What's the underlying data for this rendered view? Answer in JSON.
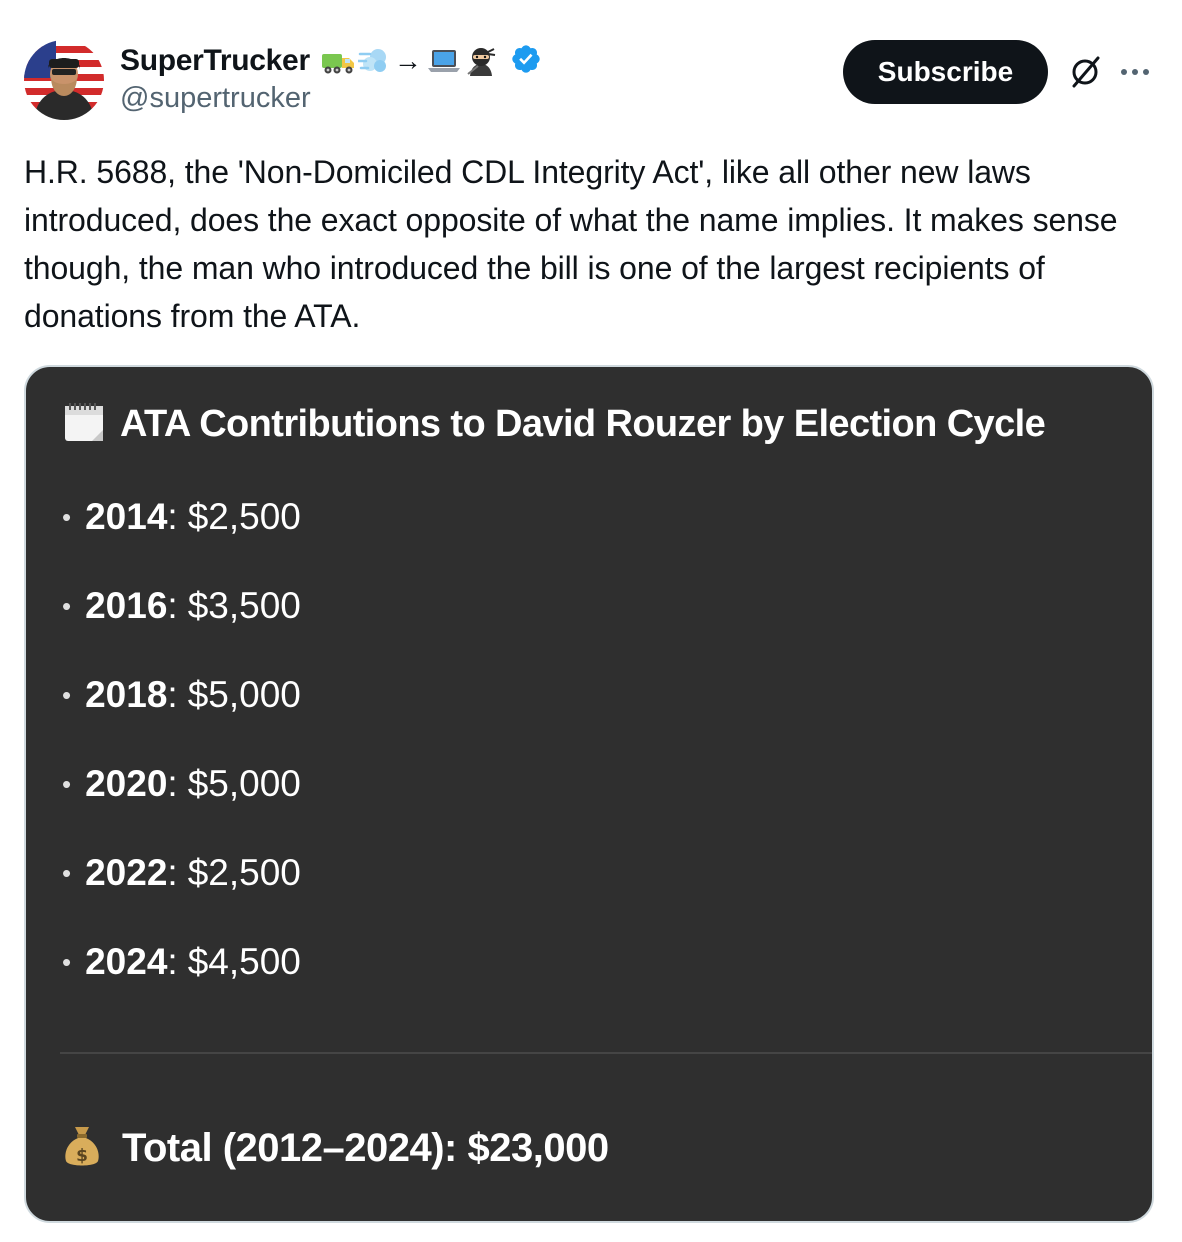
{
  "author": {
    "display_name": "SuperTrucker",
    "handle": "@supertrucker",
    "name_emoji_icons": [
      "truck-icon",
      "dash-icon",
      "arrow-right-icon",
      "laptop-icon",
      "ninja-icon"
    ],
    "arrow_glyph": "→",
    "verified": true,
    "verified_color": "#1d9bf0"
  },
  "actions": {
    "subscribe_label": "Subscribe"
  },
  "tweet": {
    "text": "H.R. 5688, the 'Non-Domiciled CDL Integrity Act', like all other new laws introduced, does the exact opposite of what the name implies. It makes sense though, the man who introduced the bill is one of the largest recipients of donations from the ATA."
  },
  "card": {
    "title_icon": "calendar-icon",
    "title": "ATA Contributions to David Rouzer by Election Cycle",
    "bullet_glyph": "•",
    "items": [
      {
        "year": "2014",
        "amount": "$2,500"
      },
      {
        "year": "2016",
        "amount": "$3,500"
      },
      {
        "year": "2018",
        "amount": "$5,000"
      },
      {
        "year": "2020",
        "amount": "$5,000"
      },
      {
        "year": "2022",
        "amount": "$2,500"
      },
      {
        "year": "2024",
        "amount": "$4,500"
      }
    ],
    "total_icon": "money-bag-icon",
    "total_text": "Total (2012–2024): $23,000"
  },
  "colors": {
    "card_background": "#2f2f2f",
    "button_background": "#0f1419",
    "secondary_text": "#536471"
  }
}
